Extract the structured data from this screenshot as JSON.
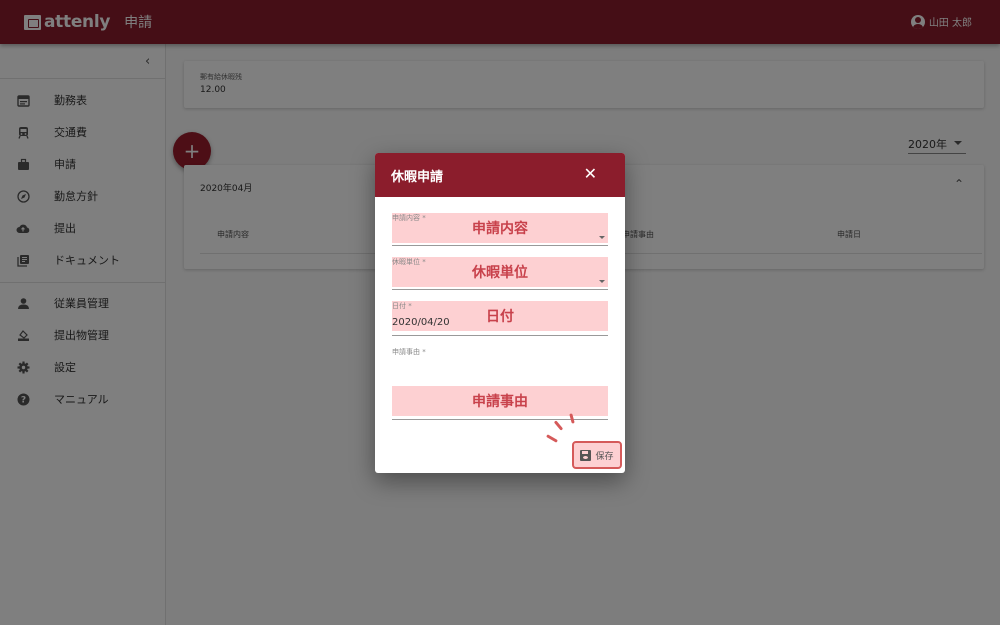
{
  "header": {
    "logo_text": "attenly",
    "page_title": "申請",
    "user_name": "山田 太郎"
  },
  "sidebar": {
    "items": [
      {
        "label": "勤務表",
        "icon": "calendar-icon"
      },
      {
        "label": "交通費",
        "icon": "train-icon"
      },
      {
        "label": "申請",
        "icon": "briefcase-icon"
      },
      {
        "label": "勤怠方針",
        "icon": "compass-icon"
      },
      {
        "label": "提出",
        "icon": "cloud-upload-icon"
      },
      {
        "label": "ドキュメント",
        "icon": "library-icon"
      },
      {
        "label": "従業員管理",
        "icon": "person-icon"
      },
      {
        "label": "提出物管理",
        "icon": "inbox-icon"
      },
      {
        "label": "設定",
        "icon": "gear-icon"
      },
      {
        "label": "マニュアル",
        "icon": "help-icon"
      }
    ]
  },
  "main": {
    "leave_label": "郵有給休暇残",
    "leave_value": "12.00",
    "year_select": "2020年",
    "month_title": "2020年04月",
    "columns": [
      "申請内容",
      "申請事由",
      "申請日"
    ]
  },
  "dialog": {
    "title": "休暇申請",
    "fields": {
      "content": {
        "label": "申請内容 *",
        "highlight": "申請内容"
      },
      "unit": {
        "label": "休暇単位 *",
        "highlight": "休暇単位"
      },
      "date": {
        "label": "日付 *",
        "value": "2020/04/20",
        "highlight": "日付"
      },
      "reason": {
        "label": "申請事由 *",
        "highlight": "申請事由"
      }
    },
    "save_label": "保存"
  },
  "colors": {
    "brand": "#8b1d2c",
    "highlight_bg": "#fdd0d2",
    "highlight_text": "#c8414b"
  }
}
